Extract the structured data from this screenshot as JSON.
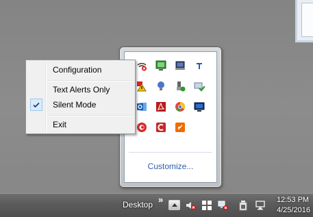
{
  "context_menu": {
    "items": [
      {
        "label": "Configuration",
        "checked": false
      },
      {
        "label": "Text Alerts Only",
        "checked": false
      },
      {
        "label": "Silent Mode",
        "checked": true
      },
      {
        "label": "Exit",
        "checked": false
      }
    ]
  },
  "overflow_area": {
    "customize_label": "Customize...",
    "icons": [
      "wifi-disconnected-icon",
      "green-monitor-icon",
      "laptop-screen-icon",
      "t-app-icon",
      "warning-flag-icon",
      "lightbulb-icon",
      "usb-eject-icon",
      "green-check-network-icon",
      "outlook-icon",
      "acrobat-icon",
      "chrome-icon",
      "blue-monitor-icon",
      "red-swirl-icon",
      "red-c-app-icon",
      "orange-note-icon"
    ]
  },
  "taskbar": {
    "desktop_label": "Desktop",
    "overflow_chevron": "»",
    "tray_icons": [
      "show-hidden-icons-button",
      "volume-muted-icon",
      "flag-action-center-icon",
      "network-error-icon",
      "power-icon",
      "display-icon"
    ],
    "clock_time": "12:53 PM",
    "clock_date": "4/25/2016"
  },
  "colors": {
    "accent_link": "#2a5ea8",
    "menu_background": "#f0f0f0",
    "taskbar": "#5b5b5b"
  }
}
